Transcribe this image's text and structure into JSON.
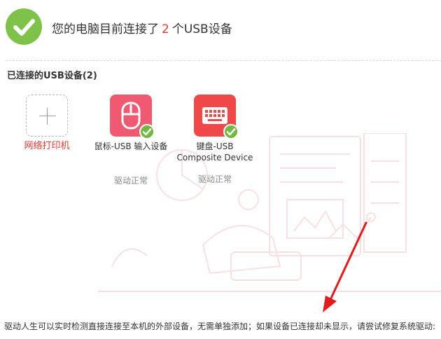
{
  "header": {
    "title_prefix": "您的电脑目前连接了",
    "count": "2",
    "title_suffix": "个USB设备",
    "check_icon": "check-icon",
    "check_color": "#7fc24a"
  },
  "section": {
    "title": "已连接的USB设备(2)"
  },
  "devices": [
    {
      "label": "网络打印机",
      "icon": "plus-icon",
      "status": ""
    },
    {
      "label": "鼠标-USB 输入设备",
      "icon": "mouse-icon",
      "status": "驱动正常",
      "color": "#ef5a72"
    },
    {
      "label_line1": "键盘-USB",
      "label_line2": "Composite Device",
      "icon": "keyboard-icon",
      "status": "驱动正常",
      "color": "#f04848"
    }
  ],
  "footer": {
    "text": "驱动人生可以实时检测直接连接至本机的外部设备，无需单独添加；如果设备已连接却未显示，请尝试修复系统驱动:"
  },
  "colors": {
    "accent_green": "#72b843",
    "accent_red": "#e53935"
  }
}
